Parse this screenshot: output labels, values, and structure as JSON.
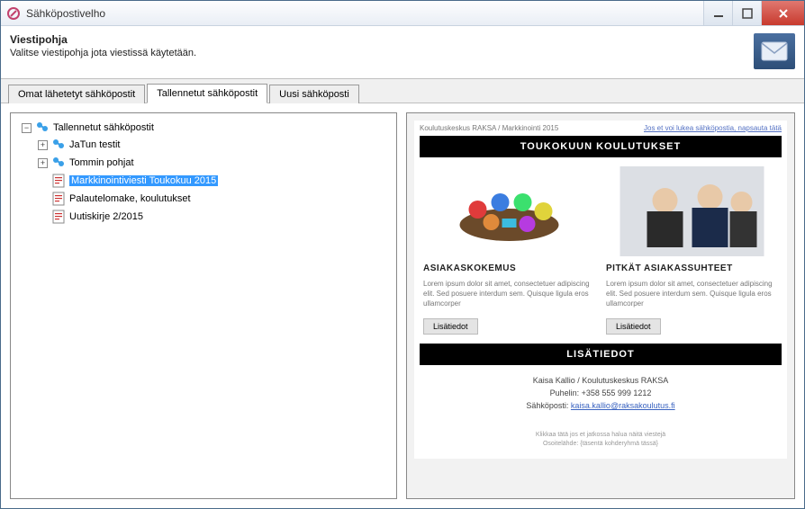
{
  "window": {
    "title": "Sähköpostivelho"
  },
  "header": {
    "title": "Viestipohja",
    "subtitle": "Valitse viestipohja jota viestissä käytetään."
  },
  "tabs": [
    {
      "label": "Omat lähetetyt sähköpostit",
      "active": false
    },
    {
      "label": "Tallennetut sähköpostit",
      "active": true
    },
    {
      "label": "Uusi sähköposti",
      "active": false
    }
  ],
  "tree": {
    "root_label": "Tallennetut sähköpostit",
    "folder1": "JaTun testit",
    "folder2": "Tommin pohjat",
    "item1": "Markkinointiviesti Toukokuu 2015",
    "item2": "Palautelomake, koulutukset",
    "item3": "Uutiskirje 2/2015"
  },
  "preview": {
    "top_left": "Koulutuskeskus RAKSA / Markkinointi 2015",
    "top_right": "Jos et voi lukea sähköpostia, napsauta tätä",
    "banner": "TOUKOKUUN KOULUTUKSET",
    "col1": {
      "title": "ASIAKASKOKEMUS",
      "body": "Lorem ipsum dolor sit amet, consectetuer adipiscing elit. Sed posuere interdum sem. Quisque ligula eros ullamcorper",
      "btn": "Lisätiedot"
    },
    "col2": {
      "title": "PITKÄT ASIAKASSUHTEET",
      "body": "Lorem ipsum dolor sit amet, consectetuer adipiscing elit. Sed posuere interdum sem. Quisque ligula eros ullamcorper",
      "btn": "Lisätiedot"
    },
    "banner2": "LISÄTIEDOT",
    "contact_line1": "Kaisa Kallio / Koulutuskeskus RAKSA",
    "contact_line2": "Puhelin: +358 555 999 1212",
    "contact_email_label": "Sähköposti: ",
    "contact_email": "kaisa.kallio@raksakoulutus.fi",
    "footer1": "Klikkaa tätä jos et jatkossa halua näitä viestejä",
    "footer2": "Osoitelähde: {täsentä kohderyhmä tässä}"
  }
}
